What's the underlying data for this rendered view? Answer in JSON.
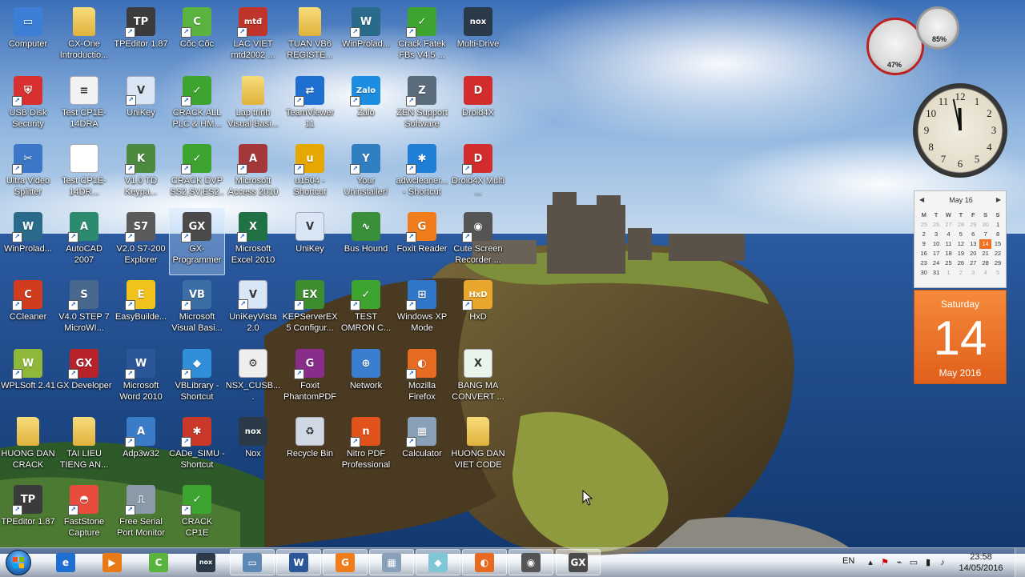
{
  "desktop": {
    "icons": [
      {
        "id": "computer",
        "label": "Computer",
        "icon": "computer-icon",
        "color": "#3d7fd6",
        "glyph": "▭",
        "shortcut": false
      },
      {
        "id": "cx-one",
        "label": "CX-One Introductio...",
        "icon": "folder-icon",
        "color": "#e9c24c",
        "glyph": "",
        "shortcut": false
      },
      {
        "id": "tpeditor",
        "label": "TPEditor 1.87",
        "icon": "tpeditor-icon",
        "color": "#3b3b3b",
        "glyph": "TP",
        "shortcut": true
      },
      {
        "id": "coccoc",
        "label": "Cốc Cốc",
        "icon": "coccoc-icon",
        "color": "#5bb33f",
        "glyph": "C",
        "shortcut": true
      },
      {
        "id": "lacviet",
        "label": "LAC VIET mtd2002 ...",
        "icon": "lacviet-icon",
        "color": "#c0352b",
        "glyph": "mtđ",
        "shortcut": true
      },
      {
        "id": "tuanvb6",
        "label": "TUAN VB6 REGISTE...",
        "icon": "folder-icon",
        "color": "#e9c24c",
        "glyph": "",
        "shortcut": false
      },
      {
        "id": "winprolad1",
        "label": "WinProlad...",
        "icon": "winproladder-icon",
        "color": "#2a6a8a",
        "glyph": "W",
        "shortcut": true
      },
      {
        "id": "crackfatek",
        "label": "Crack Fatek FBs V4.5 ...",
        "icon": "crack-icon",
        "color": "#3da52f",
        "glyph": "✓",
        "shortcut": true
      },
      {
        "id": "multidrive",
        "label": "Multi-Drive",
        "icon": "nox-icon",
        "color": "#2b3a48",
        "glyph": "nox",
        "shortcut": false
      },
      {
        "id": "usbdisk",
        "label": "USB Disk Security",
        "icon": "shield-icon",
        "color": "#d83030",
        "glyph": "⛨",
        "shortcut": true
      },
      {
        "id": "test1",
        "label": "Test CP1E-14DRA",
        "icon": "document-icon",
        "color": "#f2f2f2",
        "glyph": "≡",
        "shortcut": false
      },
      {
        "id": "unikey1",
        "label": "UniKey",
        "icon": "unikey-icon",
        "color": "#d9e6f5",
        "glyph": "V",
        "shortcut": true
      },
      {
        "id": "crackall",
        "label": "CRACK ALL PLC & HM...",
        "icon": "crack-icon",
        "color": "#3da52f",
        "glyph": "✓",
        "shortcut": true
      },
      {
        "id": "laptrinh",
        "label": "Lap trinh Visual Basi...",
        "icon": "folder-icon",
        "color": "#e9c24c",
        "glyph": "",
        "shortcut": false
      },
      {
        "id": "teamviewer",
        "label": "TeamViewer 11",
        "icon": "teamviewer-icon",
        "color": "#1e6fd0",
        "glyph": "⇄",
        "shortcut": true
      },
      {
        "id": "zalo",
        "label": "Zalo",
        "icon": "zalo-icon",
        "color": "#1c8de0",
        "glyph": "Zalo",
        "shortcut": true
      },
      {
        "id": "zensupport",
        "label": "ZEN Support Software",
        "icon": "zen-support-icon",
        "color": "#5a6b7c",
        "glyph": "Z",
        "shortcut": true
      },
      {
        "id": "droid4x",
        "label": "Droid4X",
        "icon": "droid4x-icon",
        "color": "#d22c2c",
        "glyph": "D",
        "shortcut": false
      },
      {
        "id": "ultravideo",
        "label": "Ultra Video Splitter",
        "icon": "ultra-video-splitter-icon",
        "color": "#3c77c7",
        "glyph": "✂",
        "shortcut": true
      },
      {
        "id": "test2",
        "label": "Test CP1E-14DR...",
        "icon": "document-icon",
        "color": "#ffffff",
        "glyph": "",
        "shortcut": false
      },
      {
        "id": "v10td",
        "label": "V1.0 TD Keypa...",
        "icon": "keypad-icon",
        "color": "#4b8a3f",
        "glyph": "K",
        "shortcut": true
      },
      {
        "id": "crackdvp",
        "label": "CRACK DVP SS2,SV,ES2...",
        "icon": "crack-icon",
        "color": "#3da52f",
        "glyph": "✓",
        "shortcut": true
      },
      {
        "id": "access",
        "label": "Microsoft Access 2010",
        "icon": "access-icon",
        "color": "#a4373a",
        "glyph": "A",
        "shortcut": true
      },
      {
        "id": "u1504",
        "label": "u1504 - Shortcut",
        "icon": "u1504-icon",
        "color": "#e6a800",
        "glyph": "u",
        "shortcut": true
      },
      {
        "id": "youruninstaller",
        "label": "Your Uninstaller!",
        "icon": "uninstaller-icon",
        "color": "#2f7fc1",
        "glyph": "Y",
        "shortcut": true
      },
      {
        "id": "adwcleaner",
        "label": "adwcleaner... - Shortcut",
        "icon": "adwcleaner-icon",
        "color": "#1f7ed6",
        "glyph": "✱",
        "shortcut": true
      },
      {
        "id": "droid4xmulti",
        "label": "Droid4X Multi ...",
        "icon": "droid4x-icon",
        "color": "#d22c2c",
        "glyph": "D",
        "shortcut": true
      },
      {
        "id": "winprolad2",
        "label": "WinProlad...",
        "icon": "winproladder-icon",
        "color": "#2a6a8a",
        "glyph": "W",
        "shortcut": true
      },
      {
        "id": "autocad",
        "label": "AutoCAD 2007",
        "icon": "autocad-icon",
        "color": "#2c8a6e",
        "glyph": "A",
        "shortcut": true
      },
      {
        "id": "v20s7",
        "label": "V2.0 S7-200 Explorer",
        "icon": "s7-explorer-icon",
        "color": "#5a5a5a",
        "glyph": "S7",
        "shortcut": true
      },
      {
        "id": "gxprog",
        "label": "GX-Programmer",
        "icon": "gx-programmer-icon",
        "color": "#4a4a4a",
        "glyph": "GX",
        "shortcut": true,
        "selected": true
      },
      {
        "id": "excel",
        "label": "Microsoft Excel 2010",
        "icon": "excel-icon",
        "color": "#207245",
        "glyph": "X",
        "shortcut": true
      },
      {
        "id": "unikey2",
        "label": "UniKey",
        "icon": "unikey-icon",
        "color": "#d9e6f5",
        "glyph": "V",
        "shortcut": false
      },
      {
        "id": "bushound",
        "label": "Bus Hound",
        "icon": "bus-hound-icon",
        "color": "#3a8f3a",
        "glyph": "∿",
        "shortcut": false
      },
      {
        "id": "foxitreader",
        "label": "Foxit Reader",
        "icon": "foxit-reader-icon",
        "color": "#f07c1b",
        "glyph": "G",
        "shortcut": true
      },
      {
        "id": "cutescreen",
        "label": "Cute Screen Recorder ...",
        "icon": "film-reel-icon",
        "color": "#555555",
        "glyph": "◉",
        "shortcut": true
      },
      {
        "id": "ccleaner",
        "label": "CCleaner",
        "icon": "ccleaner-icon",
        "color": "#d23c1e",
        "glyph": "C",
        "shortcut": true
      },
      {
        "id": "v40step7",
        "label": "V4.0 STEP 7 MicroWI...",
        "icon": "step7-icon",
        "color": "#48698d",
        "glyph": "S",
        "shortcut": true
      },
      {
        "id": "easybuilder",
        "label": "EasyBuilde...",
        "icon": "easybuilder-icon",
        "color": "#f1c21b",
        "glyph": "E",
        "shortcut": true
      },
      {
        "id": "vb6",
        "label": "Microsoft Visual Basi...",
        "icon": "visual-basic-icon",
        "color": "#3a6ea5",
        "glyph": "VB",
        "shortcut": true
      },
      {
        "id": "unikeyvista",
        "label": "UniKeyVista 2.0",
        "icon": "unikey-icon",
        "color": "#d9e6f5",
        "glyph": "V",
        "shortcut": true
      },
      {
        "id": "kepserver",
        "label": "KEPServerEX 5 Configur...",
        "icon": "kepserver-icon",
        "color": "#3d8d2f",
        "glyph": "EX",
        "shortcut": true
      },
      {
        "id": "testomron",
        "label": "TEST OMRON C...",
        "icon": "crack-icon",
        "color": "#3da52f",
        "glyph": "✓",
        "shortcut": true
      },
      {
        "id": "winxpmode",
        "label": "Windows XP Mode",
        "icon": "windows-xp-mode-icon",
        "color": "#2f77c8",
        "glyph": "⊞",
        "shortcut": true
      },
      {
        "id": "hxd",
        "label": "HxD",
        "icon": "hxd-icon",
        "color": "#e8a62b",
        "glyph": "HxD",
        "shortcut": true
      },
      {
        "id": "wplsoft",
        "label": "WPLSoft 2.41",
        "icon": "wplsoft-icon",
        "color": "#8fb83a",
        "glyph": "W",
        "shortcut": true
      },
      {
        "id": "gxdev",
        "label": "GX Developer",
        "icon": "gx-developer-icon",
        "color": "#b8232b",
        "glyph": "GX",
        "shortcut": true
      },
      {
        "id": "word2010",
        "label": "Microsoft Word 2010",
        "icon": "word-icon",
        "color": "#2b579a",
        "glyph": "W",
        "shortcut": true
      },
      {
        "id": "vblibrary",
        "label": "VBLibrary - Shortcut",
        "icon": "vblibrary-icon",
        "color": "#2f8fd8",
        "glyph": "◆",
        "shortcut": true
      },
      {
        "id": "nsxcusb",
        "label": "NSX_CUSB....",
        "icon": "nsx-document-icon",
        "color": "#eeeeee",
        "glyph": "⚙",
        "shortcut": false
      },
      {
        "id": "foxitphantom",
        "label": "Foxit PhantomPDF",
        "icon": "foxit-phantompdf-icon",
        "color": "#8a2c8a",
        "glyph": "G",
        "shortcut": true
      },
      {
        "id": "network",
        "label": "Network",
        "icon": "network-icon",
        "color": "#3a7ed0",
        "glyph": "⊕",
        "shortcut": false
      },
      {
        "id": "firefox",
        "label": "Mozilla Firefox",
        "icon": "firefox-icon",
        "color": "#e66a1f",
        "glyph": "◐",
        "shortcut": true
      },
      {
        "id": "bangma",
        "label": "BANG MA CONVERT ...",
        "icon": "excel-document-icon",
        "color": "#e9f4ea",
        "glyph": "X",
        "shortcut": false
      },
      {
        "id": "huongdan1",
        "label": "HUONG DAN CRACK PAS...",
        "icon": "folder-icon",
        "color": "#e9c24c",
        "glyph": "",
        "shortcut": false
      },
      {
        "id": "tailieu",
        "label": "TAI LIEU TIENG AN...",
        "icon": "folder-icon",
        "color": "#e9c24c",
        "glyph": "",
        "shortcut": false
      },
      {
        "id": "adp3w32",
        "label": "Adp3w32",
        "icon": "adp3w32-icon",
        "color": "#3b7cc9",
        "glyph": "A",
        "shortcut": true
      },
      {
        "id": "cadesimu",
        "label": "CADe_SIMU - Shortcut",
        "icon": "cade-simu-icon",
        "color": "#c9382b",
        "glyph": "✱",
        "shortcut": true
      },
      {
        "id": "nox",
        "label": "Nox",
        "icon": "nox-icon",
        "color": "#2b3a48",
        "glyph": "nox",
        "shortcut": false
      },
      {
        "id": "recyclebin",
        "label": "Recycle Bin",
        "icon": "recycle-bin-icon",
        "color": "#cfd8e3",
        "glyph": "♻",
        "shortcut": false
      },
      {
        "id": "nitropdf",
        "label": "Nitro PDF Professional",
        "icon": "nitro-pdf-icon",
        "color": "#e2521c",
        "glyph": "n",
        "shortcut": true
      },
      {
        "id": "calculator",
        "label": "Calculator",
        "icon": "calculator-icon",
        "color": "#8aa0b8",
        "glyph": "▦",
        "shortcut": true
      },
      {
        "id": "huongdan2",
        "label": "HUONG DAN VIET CODE ...",
        "icon": "folder-icon",
        "color": "#e9c24c",
        "glyph": "",
        "shortcut": false
      },
      {
        "id": "tpeditor2",
        "label": "TPEditor 1.87",
        "icon": "tpeditor-icon",
        "color": "#3b3b3b",
        "glyph": "TP",
        "shortcut": true
      },
      {
        "id": "faststone",
        "label": "FastStone Capture",
        "icon": "faststone-capture-icon",
        "color": "#e84c3d",
        "glyph": "◓",
        "shortcut": true
      },
      {
        "id": "freeserial",
        "label": "Free Serial Port Monitor",
        "icon": "serial-port-monitor-icon",
        "color": "#8a9aa8",
        "glyph": "⎍",
        "shortcut": true
      },
      {
        "id": "crackcp1e",
        "label": "CRACK CP1E",
        "icon": "crack-icon",
        "color": "#3da52f",
        "glyph": "✓",
        "shortcut": true
      }
    ]
  },
  "gadgets": {
    "cpu_meter": {
      "cpu_percent": "47%",
      "memory_percent": "85%"
    },
    "clock": {
      "hour": 11,
      "minute": 58
    },
    "calendar": {
      "month_label": "May 16",
      "weekday_headers": [
        "M",
        "T",
        "W",
        "T",
        "F",
        "S",
        "S"
      ],
      "weeks": [
        [
          "25",
          "26",
          "27",
          "28",
          "29",
          "30",
          "1"
        ],
        [
          "2",
          "3",
          "4",
          "5",
          "6",
          "7",
          "8"
        ],
        [
          "9",
          "10",
          "11",
          "12",
          "13",
          "14",
          "15"
        ],
        [
          "16",
          "17",
          "18",
          "19",
          "20",
          "21",
          "22"
        ],
        [
          "23",
          "24",
          "25",
          "26",
          "27",
          "28",
          "29"
        ],
        [
          "30",
          "31",
          "1",
          "2",
          "3",
          "4",
          "5"
        ]
      ],
      "day_name": "Saturday",
      "day_number": "14",
      "month_year": "May 2016"
    }
  },
  "taskbar": {
    "pinned": [
      {
        "name": "ie-icon",
        "color": "#1e6fd0",
        "glyph": "e",
        "active": false
      },
      {
        "name": "media-player-icon",
        "color": "#e87a18",
        "glyph": "▶",
        "active": false
      },
      {
        "name": "coccoc-icon",
        "color": "#5bb33f",
        "glyph": "C",
        "active": false
      },
      {
        "name": "nox-icon",
        "color": "#2b3a48",
        "glyph": "nox",
        "active": false
      },
      {
        "name": "window-thumbnail-icon",
        "color": "#5d87b5",
        "glyph": "▭",
        "active": true
      },
      {
        "name": "word-icon",
        "color": "#2b579a",
        "glyph": "W",
        "active": true
      },
      {
        "name": "foxit-reader-icon",
        "color": "#f07c1b",
        "glyph": "G",
        "active": true
      },
      {
        "name": "calculator-icon",
        "color": "#8aa0b8",
        "glyph": "▦",
        "active": true
      },
      {
        "name": "notes-icon",
        "color": "#7fc7d6",
        "glyph": "◆",
        "active": true
      },
      {
        "name": "firefox-icon",
        "color": "#e66a1f",
        "glyph": "◐",
        "active": true
      },
      {
        "name": "film-reel-icon",
        "color": "#555555",
        "glyph": "◉",
        "active": true
      },
      {
        "name": "gx-programmer-icon",
        "color": "#4a4a4a",
        "glyph": "GX",
        "active": true
      }
    ],
    "tray": {
      "language": "EN",
      "time": "23:58",
      "date": "14/05/2016"
    }
  }
}
